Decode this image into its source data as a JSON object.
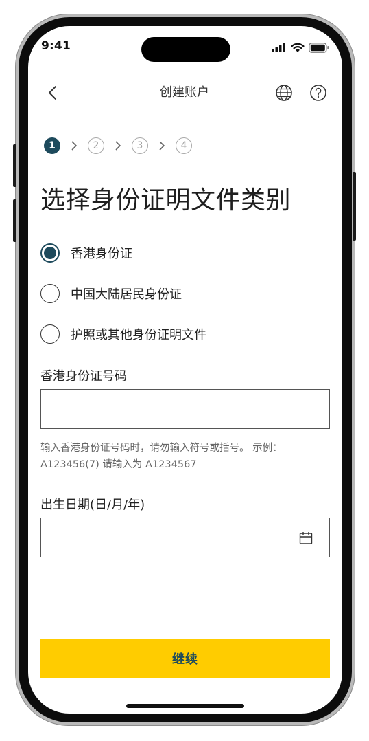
{
  "status_bar": {
    "time": "9:41"
  },
  "nav": {
    "title": "创建账户"
  },
  "stepper": {
    "steps": [
      "1",
      "2",
      "3",
      "4"
    ],
    "active_index": 0
  },
  "page": {
    "title": "选择身份证明文件类别"
  },
  "id_type_options": [
    {
      "label": "香港身份证",
      "selected": true
    },
    {
      "label": "中国大陆居民身份证",
      "selected": false
    },
    {
      "label": "护照或其他身份证明文件",
      "selected": false
    }
  ],
  "id_number": {
    "label": "香港身份证号码",
    "value": "",
    "hint_line1": "输入香港身份证号码时，请勿输入符号或括号。 示例：",
    "hint_line2": "A123456(7) 请输入为 A1234567"
  },
  "dob": {
    "label": "出生日期(日/月/年)",
    "value": ""
  },
  "continue_button": {
    "label": "继续"
  },
  "colors": {
    "accent": "#1d4a5c",
    "primary_button": "#ffcc00",
    "text": "#222222",
    "hint": "#666666"
  },
  "icons": [
    "back-chevron-icon",
    "globe-icon",
    "help-icon",
    "chevron-right-icon",
    "calendar-icon",
    "signal-icon",
    "wifi-icon",
    "battery-icon"
  ]
}
